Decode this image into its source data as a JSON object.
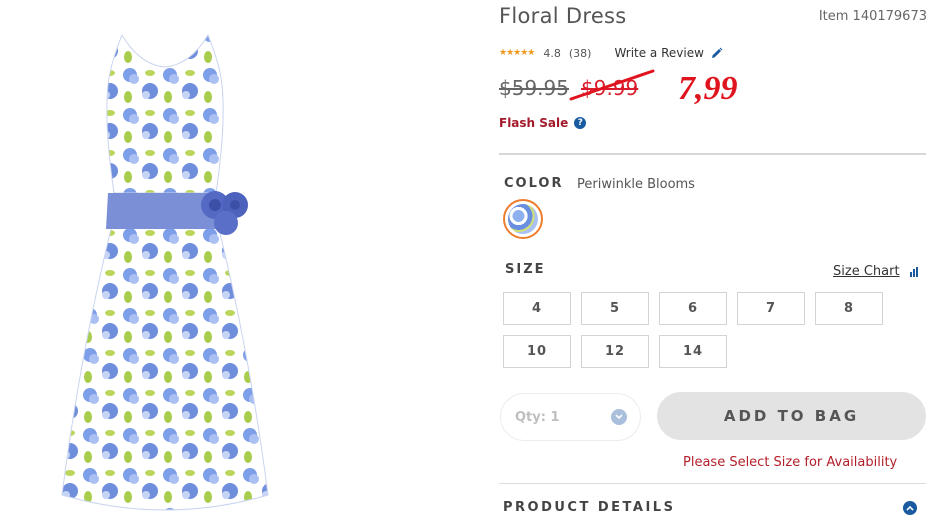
{
  "product": {
    "title": "Floral Dress",
    "item_number": "Item 140179673",
    "rating": "4.8",
    "rating_count": "(38)",
    "write_review_label": "Write a Review",
    "old_price": "$59.95",
    "sale_price": "$9.99",
    "new_price": "7,99",
    "flash_sale_label": "Flash Sale",
    "help_glyph": "?"
  },
  "color": {
    "label": "COLOR",
    "value": "Periwinkle Blooms",
    "swatch_icon": "floral-swatch"
  },
  "size": {
    "label": "SIZE",
    "chart_link": "Size Chart",
    "options": [
      "4",
      "5",
      "6",
      "7",
      "8",
      "10",
      "12",
      "14"
    ]
  },
  "purchase": {
    "qty_placeholder": "Qty: 1",
    "add_to_bag": "ADD TO BAG",
    "availability_msg": "Please Select Size for Availability"
  },
  "details": {
    "label": "PRODUCT DETAILS"
  },
  "colors": {
    "accent_blue": "#1a5aa0",
    "sale_red": "#d91c2b",
    "swatch_border": "#ee7d2e",
    "button_gray": "#e3e3e3"
  }
}
